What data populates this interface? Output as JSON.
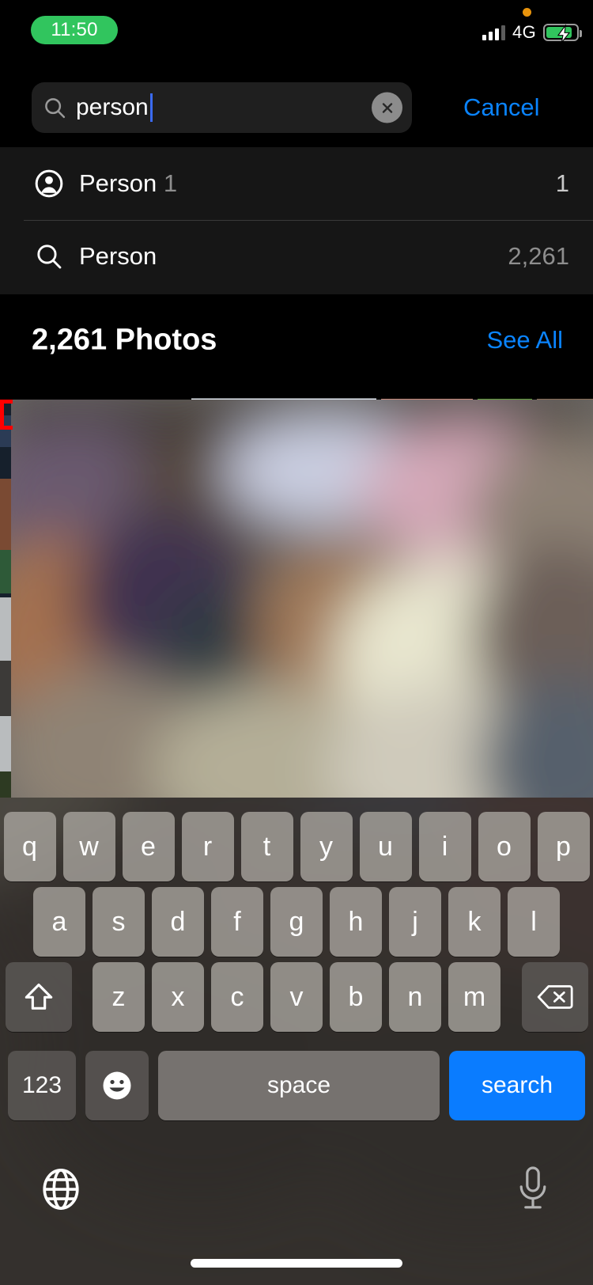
{
  "status_bar": {
    "time": "11:50",
    "time_pill_color": "#31C55E",
    "network_type": "4G",
    "recording_indicator": "orange-dot",
    "signal_icon": "cellular-signal-icon",
    "battery_icon": "battery-charging-icon",
    "battery_charging": true
  },
  "search": {
    "query": "person",
    "placeholder": "Search",
    "search_icon": "magnifier-icon",
    "clear_icon": "clear-circle-icon",
    "cancel_label": "Cancel",
    "cancel_color": "#0A84FF"
  },
  "suggestions": [
    {
      "icon": "person-circle-icon",
      "label": "Person",
      "suffix": " 1",
      "count": "1"
    },
    {
      "icon": "magnifier-icon",
      "label": "Person",
      "suffix": "",
      "count": "2,261"
    }
  ],
  "results": {
    "title": "2,261 Photos",
    "see_all_label": "See All",
    "see_all_color": "#0A84FF"
  },
  "keyboard": {
    "row1": [
      "q",
      "w",
      "e",
      "r",
      "t",
      "y",
      "u",
      "i",
      "o",
      "p"
    ],
    "row2": [
      "a",
      "s",
      "d",
      "f",
      "g",
      "h",
      "j",
      "k",
      "l"
    ],
    "row3": [
      "z",
      "x",
      "c",
      "v",
      "b",
      "n",
      "m"
    ],
    "shift_icon": "shift-arrow-icon",
    "backspace_icon": "delete-backward-icon",
    "numbers_label": "123",
    "emoji_icon": "emoji-smiley-icon",
    "space_label": "space",
    "return_label": "search",
    "return_color": "#0A7CFF",
    "globe_icon": "globe-icon",
    "dictation_icon": "microphone-icon"
  },
  "home_indicator": "home-indicator-bar"
}
